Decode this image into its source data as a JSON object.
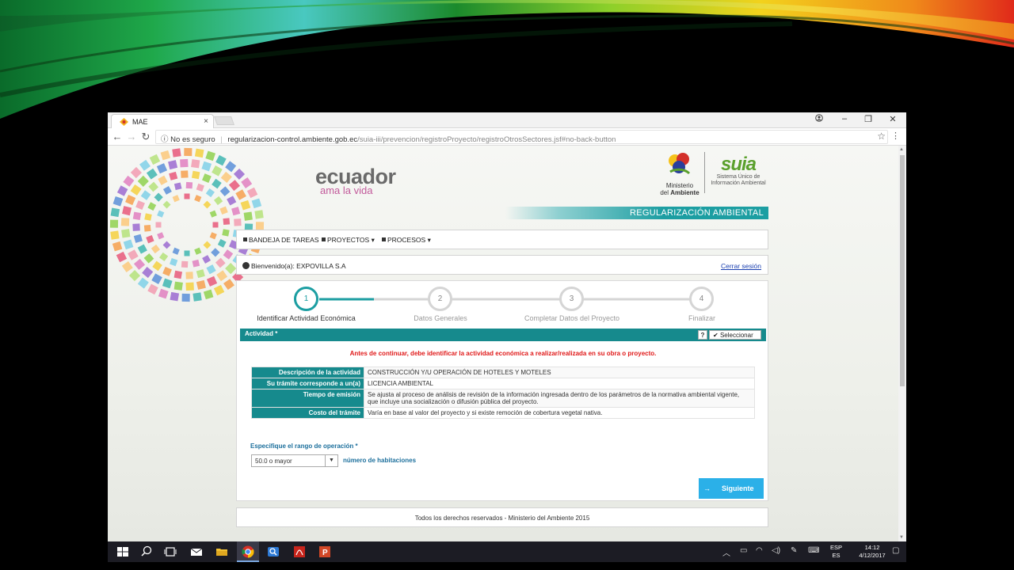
{
  "browser": {
    "tab_title": "MAE",
    "tab_close": "×",
    "security_label": "No es seguro",
    "url_domain": "regularizacion-control.ambiente.gob.ec",
    "url_path": "/suia-iii/prevencion/registroProyecto/registroOtrosSectores.jsf#no-back-button",
    "icons": [
      "back-icon",
      "forward-icon",
      "reload-icon",
      "info-icon",
      "star-icon",
      "menu-icon",
      "minimize-icon",
      "restore-icon",
      "close-icon",
      "account-icon"
    ]
  },
  "header": {
    "brand": "ecuador",
    "brand_tagline": "ama la vida",
    "ministry_line1": "Ministerio",
    "ministry_line2_prefix": "del ",
    "ministry_line2_bold": "Ambiente",
    "suia_logo": "suia",
    "suia_sub1": "Sistema Único de",
    "suia_sub2": "Información Ambiental",
    "section_banner": "REGULARIZACIÓN AMBIENTAL"
  },
  "menu": {
    "items": [
      "BANDEJA DE TAREAS",
      "PROYECTOS",
      "PROCESOS"
    ]
  },
  "session": {
    "welcome": "Bienvenido(a): EXPOVILLA S.A",
    "logout": "Cerrar sesión"
  },
  "wizard": {
    "steps": [
      {
        "number": "1",
        "label": "Identificar Actividad Económica",
        "active": true
      },
      {
        "number": "2",
        "label": "Datos Generales",
        "active": false
      },
      {
        "number": "3",
        "label": "Completar Datos del Proyecto",
        "active": false
      },
      {
        "number": "4",
        "label": "Finalizar",
        "active": false
      }
    ]
  },
  "actividad": {
    "title": "Actividad *",
    "help": "?",
    "select_button": "Seleccionar",
    "warning": "Antes de continuar, debe identificar la actividad económica a realizar/realizada en su obra o proyecto.",
    "rows": [
      {
        "label": "Descripción de la actividad",
        "value": "CONSTRUCCIÓN Y/U OPERACIÓN DE HOTELES Y MOTELES"
      },
      {
        "label": "Su trámite corresponde a un(a)",
        "value": "LICENCIA AMBIENTAL"
      },
      {
        "label": "Tiempo de emisión",
        "value": "Se ajusta al proceso de análisis de revisión de la información ingresada dentro de los parámetros de la normativa ambiental vigente, que incluye una socialización o difusión pública del proyecto."
      },
      {
        "label": "Costo del trámite",
        "value": "Varía en base al valor del proyecto y si existe remoción de cobertura vegetal nativa."
      }
    ],
    "rango_label": "Especifique el rango de operación",
    "rango_required": "*",
    "rango_value": "50.0 o mayor",
    "rango_unit": "número de habitaciones",
    "next_button": "Siguiente"
  },
  "footer": {
    "text": "Todos los derechos reservados - Ministerio del Ambiente 2015"
  },
  "taskbar": {
    "lang_top": "ESP",
    "lang_bottom": "ES",
    "time": "14:12",
    "date": "4/12/2017",
    "apps": [
      "windows-start-icon",
      "search-icon",
      "task-view-icon",
      "mail-icon",
      "file-explorer-icon",
      "chrome-icon",
      "search-app-icon",
      "acrobat-icon",
      "powerpoint-icon"
    ]
  },
  "colors": {
    "teal": "#168a8d",
    "accent": "#1c9ea2",
    "warning": "#e01919",
    "button": "#2bb0e8"
  }
}
